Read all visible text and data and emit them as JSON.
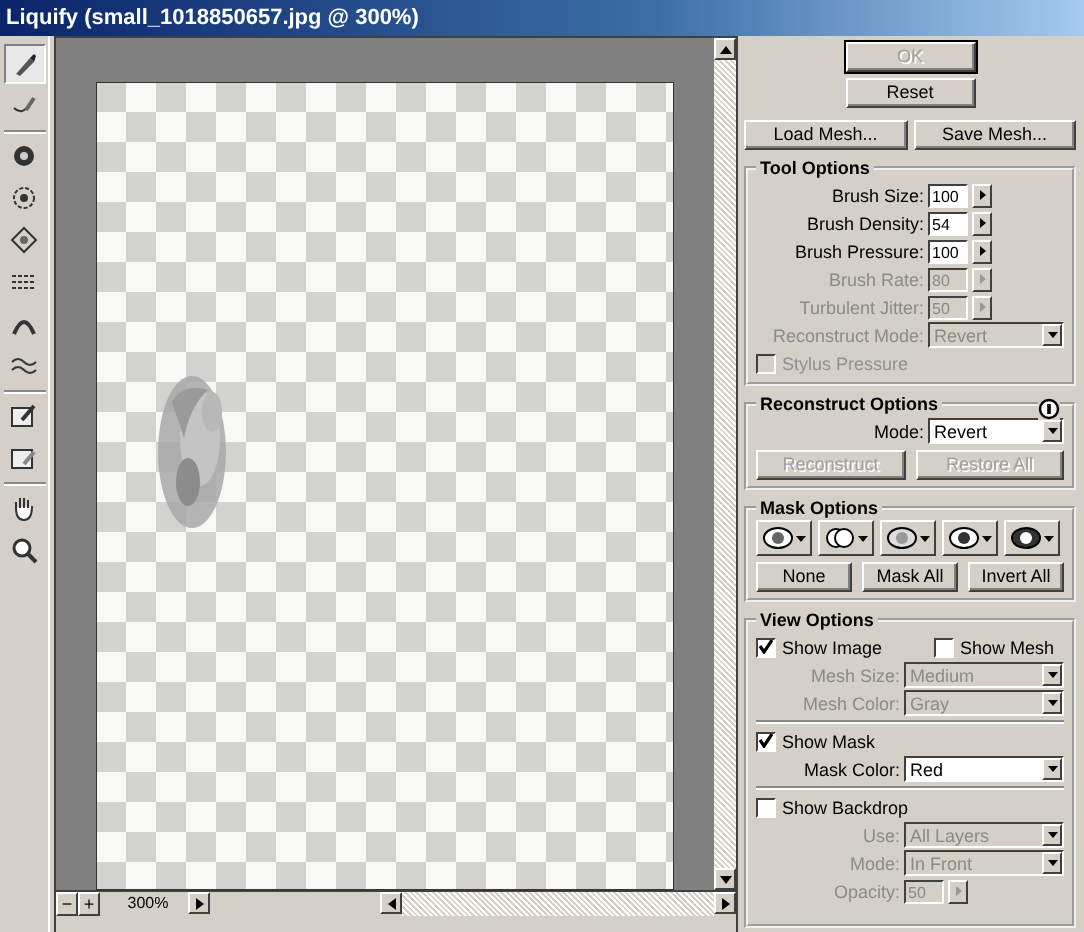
{
  "window": {
    "title": "Liquify (small_1018850657.jpg @ 300%)"
  },
  "tools": [
    [
      {
        "selected": true
      },
      {
        "selected": false
      }
    ],
    [
      {
        "selected": false
      },
      {
        "selected": false
      },
      {
        "selected": false
      },
      {
        "selected": false
      },
      {
        "selected": false
      },
      {
        "selected": false
      }
    ],
    [
      {
        "selected": false
      },
      {
        "selected": false
      }
    ],
    [
      {
        "selected": false
      },
      {
        "selected": false
      }
    ]
  ],
  "canvas": {
    "zoom_out": "−",
    "zoom_in": "+",
    "zoom": "300%"
  },
  "buttons": [
    {
      "label": "OK",
      "disabled": true
    },
    {
      "label": "Reset",
      "disabled": false
    }
  ],
  "mesh_buttons": [
    {
      "label": "Load Mesh...",
      "disabled": false
    },
    {
      "label": "Save Mesh...",
      "disabled": false
    }
  ],
  "tool_options": {
    "title": "Tool Options",
    "fields": [
      {
        "kind": "spin",
        "label": "Brush Size:",
        "value": "100",
        "disabled": false
      },
      {
        "kind": "spin",
        "label": "Brush Density:",
        "value": "54",
        "disabled": false
      },
      {
        "kind": "spin",
        "label": "Brush Pressure:",
        "value": "100",
        "disabled": false
      },
      {
        "kind": "spin",
        "label": "Brush Rate:",
        "value": "80",
        "disabled": true
      },
      {
        "kind": "spin",
        "label": "Turbulent Jitter:",
        "value": "50",
        "disabled": true
      },
      {
        "kind": "select",
        "label": "Reconstruct Mode:",
        "value": "Revert",
        "disabled": true
      },
      {
        "kind": "check",
        "label": "Stylus Pressure",
        "checked": false,
        "disabled": true
      }
    ]
  },
  "reconstruct_options": {
    "title": "Reconstruct Options",
    "fields": [
      {
        "kind": "select",
        "label": "Mode:",
        "value": "Revert",
        "disabled": false
      }
    ],
    "buttons": [
      {
        "label": "Reconstruct",
        "disabled": true
      },
      {
        "label": "Restore All",
        "disabled": true
      }
    ]
  },
  "mask_options": {
    "title": "Mask Options",
    "modes": [
      {
        "kind": "replace"
      },
      {
        "kind": "add"
      },
      {
        "kind": "subtract"
      },
      {
        "kind": "intersect"
      },
      {
        "kind": "invert"
      }
    ],
    "buttons": [
      {
        "label": "None",
        "disabled": false
      },
      {
        "label": "Mask All",
        "disabled": false
      },
      {
        "label": "Invert All",
        "disabled": false
      }
    ]
  },
  "view_options": {
    "title": "View Options",
    "fields": [
      {
        "kind": "checks",
        "items": [
          {
            "label": "Show Image",
            "checked": true,
            "disabled": false
          },
          {
            "label": "Show Mesh",
            "checked": false,
            "disabled": false
          }
        ]
      },
      {
        "kind": "select",
        "label": "Mesh Size:",
        "value": "Medium",
        "disabled": true
      },
      {
        "kind": "select",
        "label": "Mesh Color:",
        "value": "Gray",
        "disabled": true
      },
      {
        "kind": "checks",
        "items": [
          {
            "label": "Show Mask",
            "checked": true,
            "disabled": false
          }
        ]
      },
      {
        "kind": "select",
        "label": "Mask Color:",
        "value": "Red",
        "disabled": false
      },
      {
        "kind": "checks",
        "items": [
          {
            "label": "Show Backdrop",
            "checked": false,
            "disabled": false
          }
        ]
      },
      {
        "kind": "select",
        "label": "Use:",
        "value": "All Layers",
        "disabled": true
      },
      {
        "kind": "select",
        "label": "Mode:",
        "value": "In Front",
        "disabled": true
      },
      {
        "kind": "spin",
        "label": "Opacity:",
        "value": "50",
        "disabled": true
      }
    ]
  }
}
